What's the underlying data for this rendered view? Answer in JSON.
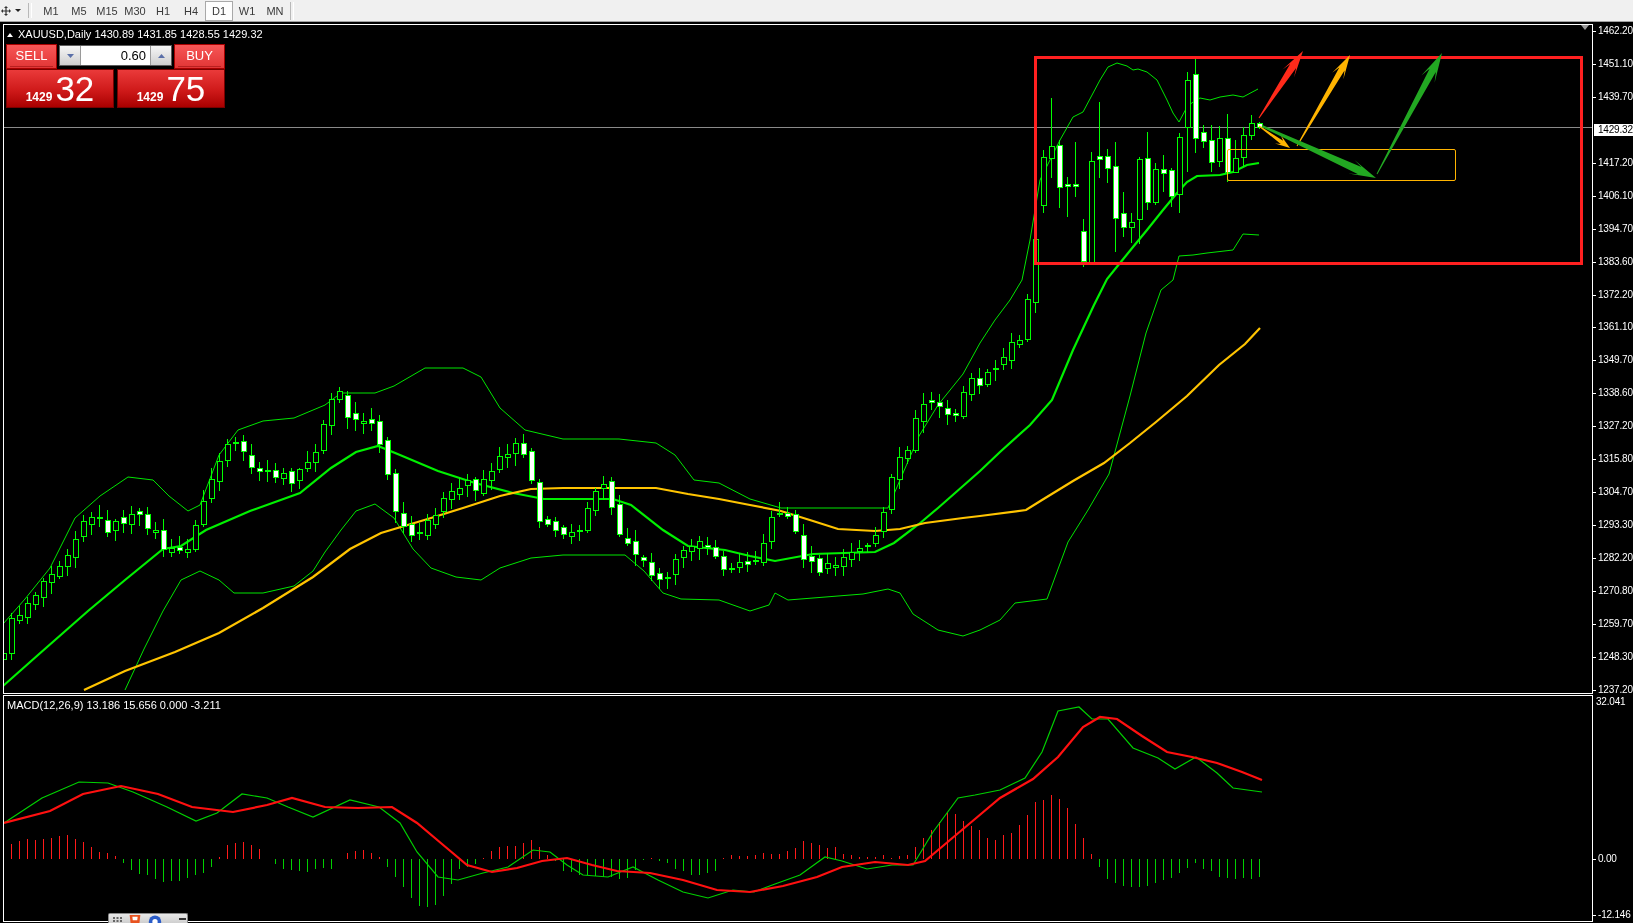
{
  "toolbar": {
    "timeframes": [
      {
        "label": "M1",
        "selected": false
      },
      {
        "label": "M5",
        "selected": false
      },
      {
        "label": "M15",
        "selected": false
      },
      {
        "label": "M30",
        "selected": false
      },
      {
        "label": "H1",
        "selected": false
      },
      {
        "label": "H4",
        "selected": false
      },
      {
        "label": "D1",
        "selected": true
      },
      {
        "label": "W1",
        "selected": false
      },
      {
        "label": "MN",
        "selected": false
      }
    ]
  },
  "chart": {
    "title": "XAUUSD,Daily 1430.89 1431.85 1428.55 1429.32",
    "trade_panel": {
      "sell_label": "SELL",
      "lot_size": "0.60",
      "buy_label": "BUY",
      "sell_price": {
        "figure": "1429",
        "pips": "32"
      },
      "buy_price": {
        "figure": "1429",
        "pips": "75"
      }
    },
    "price_axis": [
      {
        "label": "1462.20",
        "kind": "tick"
      },
      {
        "label": "1451.10",
        "kind": "tick"
      },
      {
        "label": "1439.70",
        "kind": "tick"
      },
      {
        "label": "1429.32",
        "kind": "current"
      },
      {
        "label": "1417.20",
        "kind": "tick"
      },
      {
        "label": "1406.10",
        "kind": "tick"
      },
      {
        "label": "1394.70",
        "kind": "tick"
      },
      {
        "label": "1383.60",
        "kind": "tick"
      },
      {
        "label": "1372.20",
        "kind": "tick"
      },
      {
        "label": "1361.10",
        "kind": "tick"
      },
      {
        "label": "1349.70",
        "kind": "tick"
      },
      {
        "label": "1338.60",
        "kind": "tick"
      },
      {
        "label": "1327.20",
        "kind": "tick"
      },
      {
        "label": "1315.80",
        "kind": "tick"
      },
      {
        "label": "1304.70",
        "kind": "tick"
      },
      {
        "label": "1293.30",
        "kind": "tick"
      },
      {
        "label": "1282.20",
        "kind": "tick"
      },
      {
        "label": "1270.80",
        "kind": "tick"
      },
      {
        "label": "1259.70",
        "kind": "tick"
      },
      {
        "label": "1248.30",
        "kind": "tick"
      },
      {
        "label": "1237.20",
        "kind": "tick"
      }
    ]
  },
  "macd": {
    "title": "MACD(12,26,9) 13.186 15.656 0.000 -3.211",
    "axis": [
      {
        "label": "32.041",
        "kind": "max"
      },
      {
        "label": "0.00",
        "kind": "zero"
      },
      {
        "label": "-12.146",
        "kind": "min"
      }
    ]
  }
}
